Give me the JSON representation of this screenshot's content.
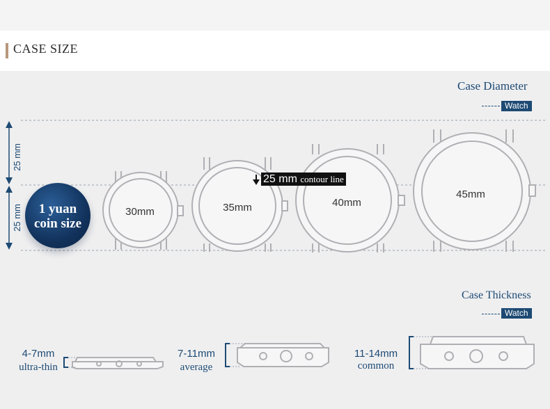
{
  "header": {
    "title": "CASE SIZE"
  },
  "diameter_section": {
    "title": "Case Diameter",
    "tag": "Watch",
    "axis_label_top": "25 mm",
    "axis_label_bottom": "25 mm",
    "coin": {
      "line1": "1 yuan",
      "line2": "coin size"
    },
    "contour": {
      "value": "25 mm",
      "label": "contour line"
    },
    "watches": [
      {
        "label": "30mm"
      },
      {
        "label": "35mm"
      },
      {
        "label": "40mm"
      },
      {
        "label": "45mm"
      }
    ]
  },
  "thickness_section": {
    "title": "Case Thickness",
    "tag": "Watch",
    "items": [
      {
        "range": "4-7mm",
        "type": "ultra-thin"
      },
      {
        "range": "7-11mm",
        "type": "average"
      },
      {
        "range": "11-14mm",
        "type": "common"
      }
    ]
  },
  "colors": {
    "accent": "#1d4a73",
    "header_bar": "#b8977b",
    "watch_outline": "#b0b0b4"
  }
}
